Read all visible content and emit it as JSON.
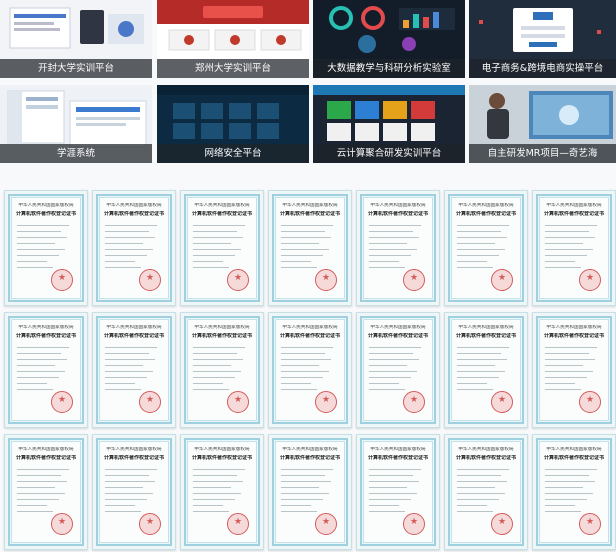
{
  "projects": [
    {
      "label": "开封大学实训平台",
      "accent": "#4a78c8"
    },
    {
      "label": "郑州大学实训平台",
      "accent": "#c0392b"
    },
    {
      "label": "大数据教学与科研分析实验室",
      "accent": "#1b2a3a"
    },
    {
      "label": "电子商务&跨境电商实操平台",
      "accent": "#2d3f55"
    },
    {
      "label": "学涯系统",
      "accent": "#3b7bd0"
    },
    {
      "label": "网络安全平台",
      "accent": "#0f3b5a"
    },
    {
      "label": "云计算聚合研发实训平台",
      "accent": "#1e78b5"
    },
    {
      "label": "自主研发MR项目—奇艺海",
      "accent": "#6a8aa6"
    }
  ],
  "certificate": {
    "issuer": "中华人民共和国国家版权局",
    "title": "计算机软件著作权登记证书",
    "count": 21
  },
  "colors": {
    "background": "#f7f9fb",
    "caption_bg": "rgba(30,34,40,0.72)",
    "certificate_border": "#9fd0df",
    "seal": "#d35b5b"
  }
}
